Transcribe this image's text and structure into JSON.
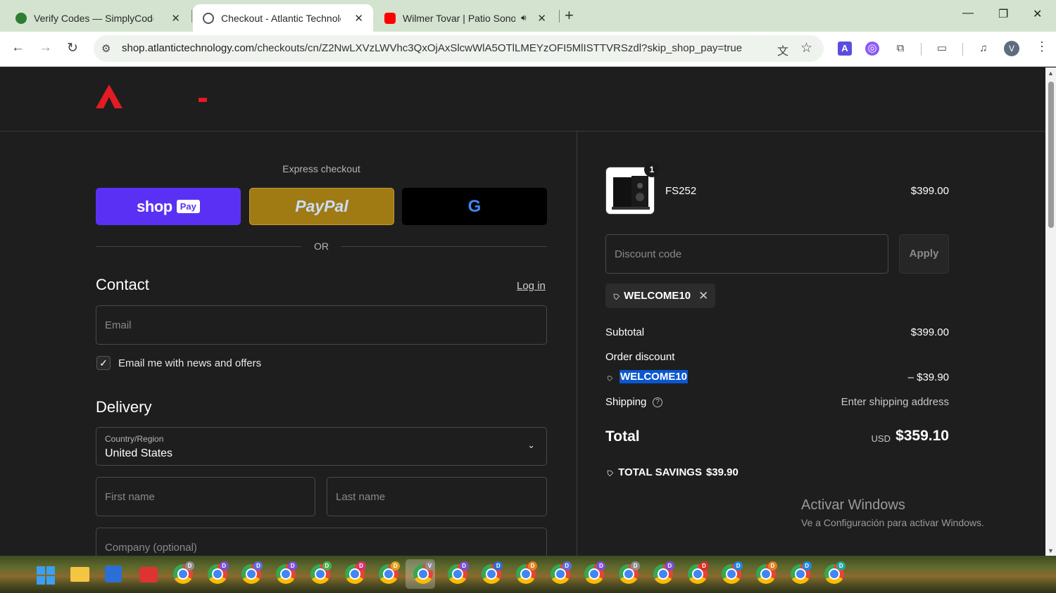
{
  "browser": {
    "tabs": [
      {
        "title": "Verify Codes — SimplyCodes",
        "favicon_color": "#2e7d32"
      },
      {
        "title": "Checkout - Atlantic Technology",
        "favicon_color": "#555555"
      },
      {
        "title": "Wilmer Tovar | Patio Sonoro",
        "favicon_color": "#ff0000"
      }
    ],
    "url_host": "shop.atlantictechnology.com",
    "url_path": "/checkouts/cn/Z2NwLXVzLWVhc3QxOjAxSlcwWlA5OTlLMEYzOFI5MlISTTVRSzdl?skip_shop_pay=true",
    "profile_initial": "V"
  },
  "express": {
    "label": "Express checkout",
    "shop_pay": "shop",
    "shop_pay_tag": "Pay",
    "paypal": "PayPal",
    "google": "G",
    "or_text": "OR"
  },
  "contact": {
    "title": "Contact",
    "login": "Log in",
    "email_placeholder": "Email",
    "newsletter_label": "Email me with news and offers",
    "newsletter_checked": true
  },
  "delivery": {
    "title": "Delivery",
    "country_label": "Country/Region",
    "country_value": "United States",
    "first_name_placeholder": "First name",
    "last_name_placeholder": "Last name",
    "company_placeholder": "Company (optional)"
  },
  "summary": {
    "item": {
      "name": "FS252",
      "price": "$399.00",
      "quantity": "1"
    },
    "discount_placeholder": "Discount code",
    "apply_label": "Apply",
    "applied_code": "WELCOME10",
    "subtotal_label": "Subtotal",
    "subtotal_value": "$399.00",
    "order_discount_label": "Order discount",
    "discount_code": "WELCOME10",
    "discount_value": "– $39.90",
    "shipping_label": "Shipping",
    "shipping_value": "Enter shipping address",
    "total_label": "Total",
    "total_currency": "USD",
    "total_value": "$359.10",
    "savings_label": "TOTAL SAVINGS",
    "savings_value": "$39.90"
  },
  "watermark": {
    "title": "Activar Windows",
    "subtitle": "Ve a Configuración para activar Windows."
  },
  "colors": {
    "brand_red": "#e31b23",
    "shop_pay": "#5a31f4",
    "paypal": "#a07a13",
    "highlight": "#0b57d0"
  },
  "taskbar_badges": [
    "D",
    "D",
    "D",
    "D",
    "D",
    "D",
    "D",
    "V",
    "D",
    "D",
    "D",
    "D",
    "D",
    "D",
    "D",
    "D",
    "D",
    "D",
    "D",
    "D"
  ]
}
